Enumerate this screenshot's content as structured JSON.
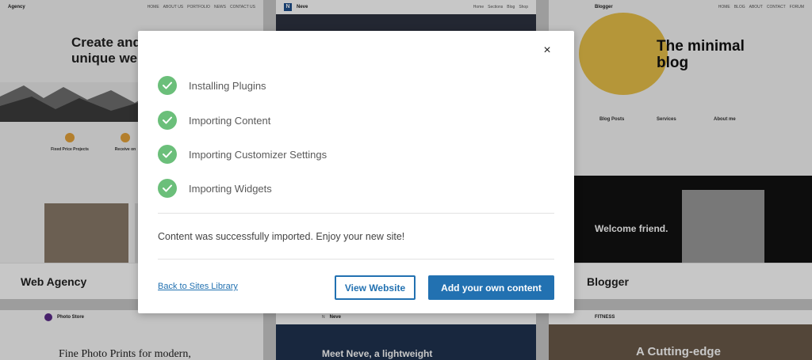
{
  "modal": {
    "close_icon": "×",
    "steps": [
      {
        "label": "Installing Plugins",
        "status": "done"
      },
      {
        "label": "Importing Content",
        "status": "done"
      },
      {
        "label": "Importing Customizer Settings",
        "status": "done"
      },
      {
        "label": "Importing Widgets",
        "status": "done"
      }
    ],
    "message": "Content was successfully imported. Enjoy your new site!",
    "back_link": "Back to Sites Library",
    "view_button": "View Website",
    "add_button": "Add your own content",
    "accent_color": "#2271b1",
    "check_color": "#6bbf7a"
  },
  "background": {
    "cards": [
      {
        "name": "Web Agency",
        "logo": "Agency",
        "nav": [
          "HOME",
          "ABOUT US",
          "PORTFOLIO",
          "NEWS",
          "CONTACT US"
        ],
        "hero": "Create and g\nunique webs",
        "features": [
          "Fixed Price Projects",
          "Receive on"
        ]
      },
      {
        "name": "Neve",
        "logo": "Neve",
        "nav": [
          "Home",
          "Sections",
          "Blog",
          "Shop"
        ]
      },
      {
        "name": "Blogger",
        "logo": "Blogger",
        "nav": [
          "HOME",
          "BLOG",
          "ABOUT",
          "CONTACT",
          "FORUM"
        ],
        "hero": "The minimal\nblog",
        "columns": [
          "Blog Posts",
          "Services",
          "About me"
        ],
        "banner": "Welcome friend."
      },
      {
        "logo": "Photo Store",
        "hero": "Fine Photo Prints for modern,"
      },
      {
        "logo": "Neve",
        "hero": "Meet Neve, a lightweight"
      },
      {
        "logo": "FITNESS",
        "hero": "A Cutting-edge"
      }
    ]
  }
}
